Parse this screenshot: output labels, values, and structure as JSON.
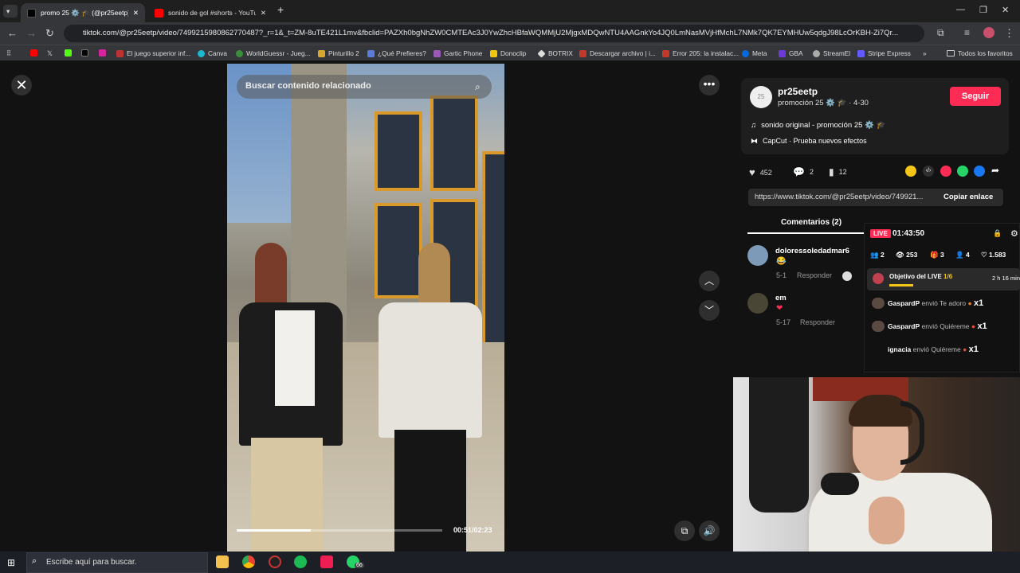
{
  "browser": {
    "tabs": [
      {
        "label": "promo 25 ⚙️ 🎓 (@pr25eetp) |"
      },
      {
        "label": "sonido de gol #shorts - YouTub"
      }
    ],
    "new_tab": "+",
    "url": "tiktok.com/@pr25eetp/video/7499215980862770487?_r=1&_t=ZM-8uTE421L1mv&fbclid=PAZXh0bgNhZW0CMTEAc3J0YwZhcHBfaWQMMjU2MjgxMDQwNTU4AAGnkYo4JQ0LmNasMVjHfMchL7NMk7QK7EYMHUw5qdgJ98LcOrKBH-Zi7Qr...",
    "bookmarks": [
      "El juego superior inf...",
      "Canva",
      "WorldGuessr - Jueg...",
      "Pinturillo 2",
      "¿Qué Prefieres?",
      "Gartic Phone",
      "Donoclip",
      "BOTRIX",
      "Descargar archivo | i...",
      "Error 205: la instalac...",
      "Meta",
      "GBA",
      "StreamEl",
      "Stripe Express"
    ],
    "all_favorites": "Todos los favoritos"
  },
  "player": {
    "search_placeholder": "Buscar contenido relacionado",
    "time": "00:51/02:23",
    "progress": 0.36
  },
  "profile": {
    "avatar_text": "25",
    "username": "pr25eetp",
    "display": "promoción 25 ⚙️ 🎓 · 4-30",
    "follow": "Seguir",
    "sound": "sonido original - promoción 25 ⚙️ 🎓",
    "capcut": "CapCut · Prueba nuevos efectos"
  },
  "stats": {
    "likes": "452",
    "comments": "2",
    "saves": "12"
  },
  "link": {
    "url": "https://www.tiktok.com/@pr25eetp/video/749921...",
    "copy": "Copiar enlace"
  },
  "tabs": {
    "comments": "Comentarios (2)"
  },
  "comments": [
    {
      "user": "doloressoledadmar6",
      "text": "😂",
      "date": "5-1",
      "reply": "Responder"
    },
    {
      "user": "em",
      "text": "❤",
      "date": "5-17",
      "reply": "Responder"
    }
  ],
  "live": {
    "badge": "LIVE",
    "timer": "01:43:50",
    "stats": [
      "2",
      "253",
      "3",
      "4",
      "1.583"
    ],
    "goal": "Objetivo del LIVE",
    "goal_progress": "1/6",
    "goal_time": "2 h 16 min",
    "events": [
      {
        "user": "GaspardP",
        "text": "envió Te adoro",
        "count": "x1"
      },
      {
        "user": "GaspardP",
        "text": "envió Quiéreme",
        "count": "x1"
      },
      {
        "user": "ignacia",
        "text": "envió Quiéreme",
        "count": "x1"
      }
    ]
  },
  "taskbar": {
    "search_placeholder": "Escribe aquí para buscar.",
    "whatsapp_badge": "66"
  },
  "colors": {
    "accent": "#fe2c55",
    "bg": "#121212",
    "chrome": "#35363a"
  }
}
